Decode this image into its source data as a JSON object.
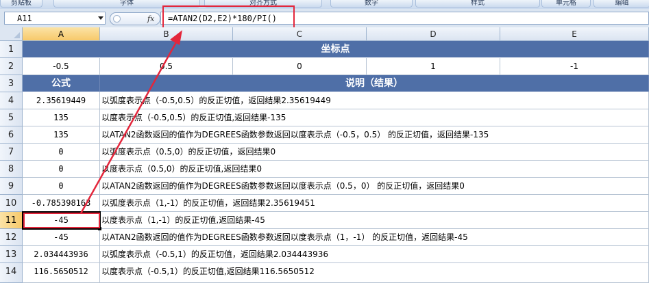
{
  "ribbon": {
    "groups": [
      "剪贴板",
      "字体",
      "对齐方式",
      "数字",
      "样式",
      "单元格",
      "编辑"
    ]
  },
  "formula_bar": {
    "name_box": "A11",
    "fx_label": "fx",
    "formula": "=ATAN2(D2,E2)*180/PI()"
  },
  "columns": [
    "A",
    "B",
    "C",
    "D",
    "E"
  ],
  "active_cell": "A11",
  "sheet": {
    "title": "坐标点",
    "coords": [
      "-0.5",
      "0.5",
      "0",
      "1",
      "-1"
    ],
    "header_formula": "公式",
    "header_desc": "说明（结果）",
    "rows": [
      {
        "num": "1"
      },
      {
        "num": "2"
      },
      {
        "num": "3"
      },
      {
        "num": "4",
        "a": "2.35619449",
        "b": "以弧度表示点（-0.5,0.5）的反正切值，返回结果2.35619449"
      },
      {
        "num": "5",
        "a": "135",
        "b": "以度表示点（-0.5,0.5）的反正切值,返回结果-135"
      },
      {
        "num": "6",
        "a": "135",
        "b": "以ATAN2函数返回的值作为DEGREES函数参数返回以度表示点（-0.5，0.5） 的反正切值，返回结果-135"
      },
      {
        "num": "7",
        "a": "0",
        "b": "以弧度表示点（0.5,0）的反正切值，返回结果0"
      },
      {
        "num": "8",
        "a": "0",
        "b": "以度表示点（0.5,0）的反正切值,返回结果0"
      },
      {
        "num": "9",
        "a": "0",
        "b": "以ATAN2函数返回的值作为DEGREES函数参数返回以度表示点（0.5，0） 的反正切值，返回结果0"
      },
      {
        "num": "10",
        "a": "-0.785398163",
        "b": "以弧度表示点（1,-1）的反正切值，返回结果2.35619451"
      },
      {
        "num": "11",
        "a": "-45",
        "b": "以度表示点（1,-1）的反正切值,返回结果-45"
      },
      {
        "num": "12",
        "a": "-45",
        "b": "以ATAN2函数返回的值作为DEGREES函数参数返回以度表示点（1，-1） 的反正切值，返回结果-45"
      },
      {
        "num": "13",
        "a": "2.034443936",
        "b": "以弧度表示点（-0.5,1）的反正切值，返回结果2.034443936"
      },
      {
        "num": "14",
        "a": "116.5650512",
        "b": "以度表示点（-0.5,1）的反正切值,返回结果116.5650512"
      }
    ]
  },
  "colors": {
    "header_fill": "#4f6fa7",
    "callout": "#e3263b",
    "selected_header": "#f7c96a"
  }
}
